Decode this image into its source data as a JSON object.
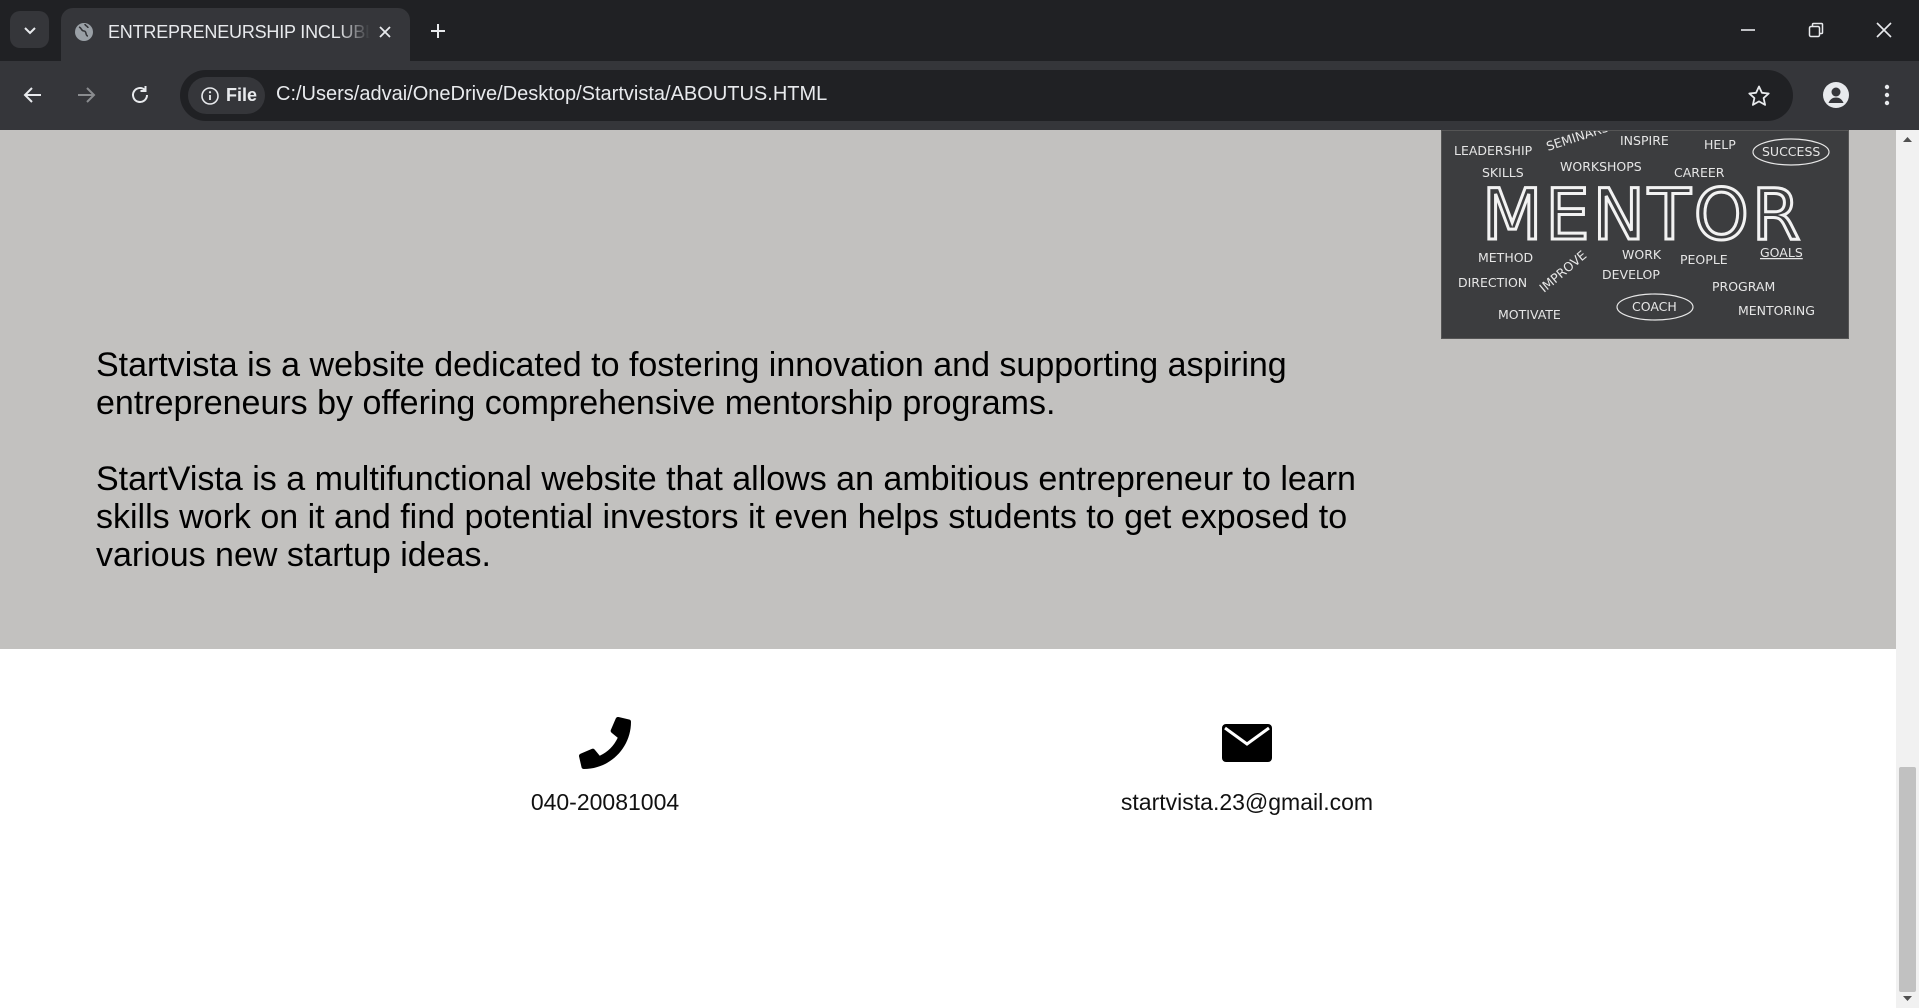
{
  "browser": {
    "tab_title": "ENTREPRENEURSHIP INCLUBLATOR",
    "new_tab_symbol": "+",
    "file_chip": "File",
    "url": "C:/Users/advai/OneDrive/Desktop/Startvista/ABOUTUS.HTML"
  },
  "about": {
    "paragraph1": "Startvista is a website dedicated to fostering innovation and supporting aspiring entrepreneurs by offering comprehensive mentorship programs.",
    "paragraph2": "StartVista is a multifunctional website that allows an ambitious entrepreneur to learn skills work on it and find potential investors it even helps students to get exposed to various new startup ideas."
  },
  "mentor_image": {
    "main_word": "MENTOR",
    "words": [
      "LEADERSHIP",
      "SEMINARS",
      "INSPIRE",
      "HELP",
      "SUCCESS",
      "SKILLS",
      "WORKSHOPS",
      "CAREER",
      "METHOD",
      "IMPROVE",
      "WORK",
      "PEOPLE",
      "GOALS",
      "DIRECTION",
      "DEVELOP",
      "PROGRAM",
      "MOTIVATE",
      "COACH",
      "MENTORING"
    ]
  },
  "contact": {
    "phone": "040-20081004",
    "email": "startvista.23@gmail.com"
  },
  "icons": {
    "phone": "phone-icon",
    "email": "envelope-icon"
  }
}
